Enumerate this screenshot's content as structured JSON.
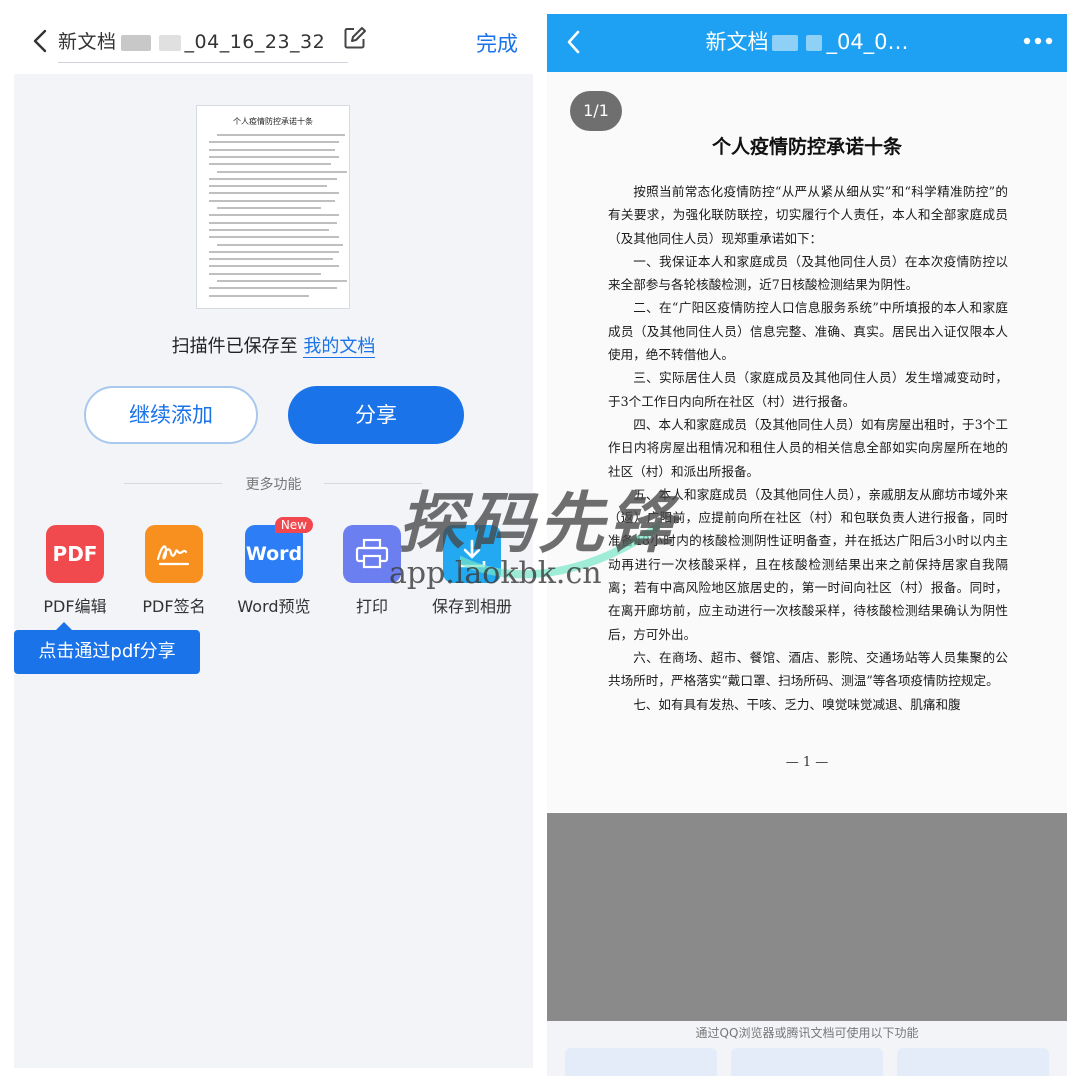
{
  "left": {
    "title_prefix": "新文档",
    "title_suffix": "_04_16_23_32",
    "done_label": "完成",
    "saved_text": "扫描件已保存至",
    "saved_link": "我的文档",
    "continue_label": "继续添加",
    "share_label": "分享",
    "more_label": "更多功能",
    "tools": [
      {
        "name": "PDF编辑",
        "tile_text": "PDF",
        "color": "#f04a4f"
      },
      {
        "name": "PDF签名",
        "tile_text": "",
        "color": "#f7901e"
      },
      {
        "name": "Word预览",
        "tile_text": "Word",
        "color": "#2d7ef6",
        "badge": "New"
      },
      {
        "name": "打印",
        "tile_text": "",
        "color": "#6b7ff0"
      },
      {
        "name": "保存到相册",
        "tile_text": "",
        "color": "#23a9f2"
      }
    ],
    "tooltip": "点击通过pdf分享",
    "thumb_title": "个人疫情防控承诺十条"
  },
  "right": {
    "title_prefix": "新文档",
    "title_suffix": "_04_0…",
    "page_badge": "1/1",
    "doc_title": "个人疫情防控承诺十条",
    "paragraphs": [
      "按照当前常态化疫情防控“从严从紧从细从实”和“科学精准防控”的有关要求，为强化联防联控，切实履行个人责任，本人和全部家庭成员（及其他同住人员）现郑重承诺如下：",
      "一、我保证本人和家庭成员（及其他同住人员）在本次疫情防控以来全部参与各轮核酸检测，近7日核酸检测结果为阴性。",
      "二、在“广阳区疫情防控人口信息服务系统”中所填报的本人和家庭成员（及其他同住人员）信息完整、准确、真实。居民出入证仅限本人使用，绝不转借他人。",
      "三、实际居住人员（家庭成员及其他同住人员）发生增减变动时，于3个工作日内向所在社区（村）进行报备。",
      "四、本人和家庭成员（及其他同住人员）如有房屋出租时，于3个工作日内将房屋出租情况和租住人员的相关信息全部如实向房屋所在地的社区（村）和派出所报备。",
      "五、本人和家庭成员（及其他同住人员），亲戚朋友从廊坊市域外来（返）广阳前，应提前向所在社区（村）和包联负责人进行报备，同时准备48小时内的核酸检测阴性证明备查，并在抵达广阳后3小时以内主动再进行一次核酸采样，且在核酸检测结果出来之前保持居家自我隔离；若有中高风险地区旅居史的，第一时间向社区（村）报备。同时，在离开廊坊前，应主动进行一次核酸采样，待核酸检测结果确认为阴性后，方可外出。",
      "六、在商场、超市、餐馆、酒店、影院、交通场站等人员集聚的公共场所时，严格落实“戴口罩、扫场所码、测温”等各项疫情防控规定。",
      "七、如有具有发热、干咳、乏力、嗅觉味觉减退、肌痛和腹"
    ],
    "page_num": "— 1 —",
    "bottom_hint": "通过QQ浏览器或腾讯文档可使用以下功能"
  },
  "watermark": {
    "text": "探码先锋",
    "url": "app.laokbk.cn"
  },
  "colors": {
    "accent": "#1a73e8",
    "right_header": "#1ea1f2"
  }
}
